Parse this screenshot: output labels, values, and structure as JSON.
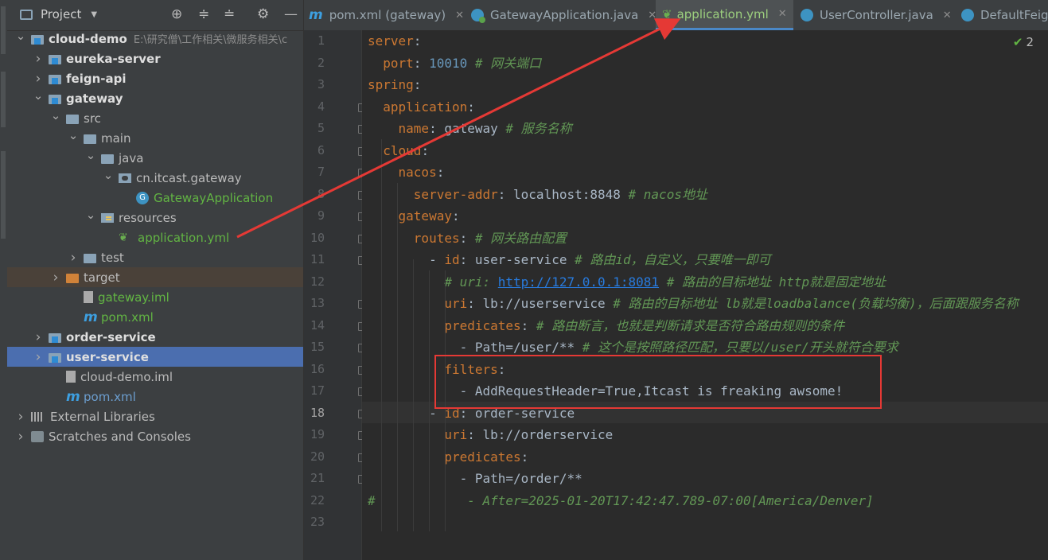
{
  "project_panel": {
    "title": "Project",
    "tree": [
      {
        "label": "cloud-demo",
        "path": "E:\\研究僧\\工作相关\\微服务相关\\c",
        "depth": 0,
        "expanded": true,
        "icon": "module-folder-icon",
        "style": "bold"
      },
      {
        "label": "eureka-server",
        "depth": 1,
        "expanded": false,
        "icon": "module-folder-icon",
        "style": "bold"
      },
      {
        "label": "feign-api",
        "depth": 1,
        "expanded": false,
        "icon": "module-folder-icon",
        "style": "bold"
      },
      {
        "label": "gateway",
        "depth": 1,
        "expanded": true,
        "icon": "module-folder-icon",
        "style": "bold"
      },
      {
        "label": "src",
        "depth": 2,
        "expanded": true,
        "icon": "folder-icon",
        "style": "normal"
      },
      {
        "label": "main",
        "depth": 3,
        "expanded": true,
        "icon": "folder-icon",
        "style": "normal"
      },
      {
        "label": "java",
        "depth": 4,
        "expanded": true,
        "icon": "source-folder-icon",
        "style": "normal"
      },
      {
        "label": "cn.itcast.gateway",
        "depth": 5,
        "expanded": true,
        "icon": "package-icon",
        "style": "normal"
      },
      {
        "label": "GatewayApplication",
        "depth": 6,
        "icon": "spring-class-icon",
        "style": "green"
      },
      {
        "label": "resources",
        "depth": 4,
        "expanded": true,
        "icon": "resources-folder-icon",
        "style": "normal"
      },
      {
        "label": "application.yml",
        "depth": 5,
        "icon": "spring-yaml-icon",
        "style": "green"
      },
      {
        "label": "test",
        "depth": 3,
        "expanded": false,
        "icon": "folder-icon",
        "style": "normal"
      },
      {
        "label": "target",
        "depth": 2,
        "expanded": false,
        "icon": "excluded-folder-icon",
        "style": "normal",
        "row": "excluded"
      },
      {
        "label": "gateway.iml",
        "depth": 3,
        "icon": "iml-file-icon",
        "style": "green"
      },
      {
        "label": "pom.xml",
        "depth": 3,
        "icon": "maven-icon",
        "style": "green"
      },
      {
        "label": "order-service",
        "depth": 1,
        "expanded": false,
        "icon": "module-folder-icon",
        "style": "bold"
      },
      {
        "label": "user-service",
        "depth": 1,
        "expanded": false,
        "icon": "module-folder-icon",
        "style": "bold",
        "row": "selected"
      },
      {
        "label": "cloud-demo.iml",
        "depth": 2,
        "icon": "iml-file-icon",
        "style": "normal"
      },
      {
        "label": "pom.xml",
        "depth": 2,
        "icon": "maven-icon",
        "style": "blue"
      },
      {
        "label": "External Libraries",
        "depth": 0,
        "expanded": false,
        "icon": "libraries-icon",
        "style": "normal"
      },
      {
        "label": "Scratches and Consoles",
        "depth": 0,
        "expanded": false,
        "icon": "scratches-icon",
        "style": "normal"
      }
    ]
  },
  "tabs": [
    {
      "label": "pom.xml (gateway)",
      "icon": "maven-icon",
      "active": false
    },
    {
      "label": "GatewayApplication.java",
      "icon": "spring-class-icon",
      "active": false
    },
    {
      "label": "application.yml",
      "icon": "spring-yaml-icon",
      "active": true
    },
    {
      "label": "UserController.java",
      "icon": "class-icon",
      "active": false
    },
    {
      "label": "DefaultFeig",
      "icon": "class-icon",
      "active": false
    }
  ],
  "editor": {
    "inspection_count": "2",
    "current_line": 18,
    "lines": [
      {
        "n": "1",
        "indent": 0,
        "tokens": [
          [
            "k",
            "server"
          ],
          [
            "v",
            ":"
          ]
        ]
      },
      {
        "n": "2",
        "indent": 2,
        "tokens": [
          [
            "k",
            "port"
          ],
          [
            "v",
            ": "
          ],
          [
            "n",
            "10010"
          ],
          [
            "c",
            " # 网关端口"
          ]
        ]
      },
      {
        "n": "3",
        "indent": 0,
        "tokens": [
          [
            "k",
            "spring"
          ],
          [
            "v",
            ":"
          ]
        ]
      },
      {
        "n": "4",
        "indent": 2,
        "tokens": [
          [
            "k",
            "application"
          ],
          [
            "v",
            ":"
          ]
        ]
      },
      {
        "n": "5",
        "indent": 4,
        "tokens": [
          [
            "k",
            "name"
          ],
          [
            "v",
            ": gateway"
          ],
          [
            "c",
            " # 服务名称"
          ]
        ]
      },
      {
        "n": "6",
        "indent": 2,
        "tokens": [
          [
            "k",
            "cloud"
          ],
          [
            "v",
            ":"
          ]
        ]
      },
      {
        "n": "7",
        "indent": 4,
        "tokens": [
          [
            "k",
            "nacos"
          ],
          [
            "v",
            ":"
          ]
        ]
      },
      {
        "n": "8",
        "indent": 6,
        "tokens": [
          [
            "k",
            "server-addr"
          ],
          [
            "v",
            ": localhost:8848"
          ],
          [
            "c",
            " # nacos地址"
          ]
        ]
      },
      {
        "n": "9",
        "indent": 4,
        "tokens": [
          [
            "k",
            "gateway"
          ],
          [
            "v",
            ":"
          ]
        ]
      },
      {
        "n": "10",
        "indent": 6,
        "tokens": [
          [
            "k",
            "routes"
          ],
          [
            "v",
            ":"
          ],
          [
            "c",
            " # 网关路由配置"
          ]
        ]
      },
      {
        "n": "11",
        "indent": 8,
        "tokens": [
          [
            "v",
            "- "
          ],
          [
            "k",
            "id"
          ],
          [
            "v",
            ": user-service"
          ],
          [
            "c",
            " # 路由id，自定义，只要唯一即可"
          ]
        ]
      },
      {
        "n": "12",
        "indent": 10,
        "tokens": [
          [
            "c",
            "# uri: "
          ],
          [
            "u",
            "http://127.0.0.1:8081"
          ],
          [
            "c",
            " # 路由的目标地址 http就是固定地址"
          ]
        ]
      },
      {
        "n": "13",
        "indent": 10,
        "tokens": [
          [
            "k",
            "uri"
          ],
          [
            "v",
            ": lb://userservice"
          ],
          [
            "c",
            " # 路由的目标地址 lb就是loadbalance(负载均衡)，后面跟服务名称"
          ]
        ]
      },
      {
        "n": "14",
        "indent": 10,
        "tokens": [
          [
            "k",
            "predicates"
          ],
          [
            "v",
            ":"
          ],
          [
            "c",
            " # 路由断言，也就是判断请求是否符合路由规则的条件"
          ]
        ]
      },
      {
        "n": "15",
        "indent": 12,
        "tokens": [
          [
            "v",
            "- Path=/user/**"
          ],
          [
            "c",
            " # 这个是按照路径匹配，只要以/user/开头就符合要求"
          ]
        ]
      },
      {
        "n": "16",
        "indent": 10,
        "tokens": [
          [
            "k",
            "filters"
          ],
          [
            "v",
            ":"
          ]
        ]
      },
      {
        "n": "17",
        "indent": 12,
        "tokens": [
          [
            "v",
            "- AddRequestHeader=True,Itcast is freaking awsome!"
          ]
        ]
      },
      {
        "n": "18",
        "indent": 8,
        "tokens": [
          [
            "v",
            "- "
          ],
          [
            "k",
            "id"
          ],
          [
            "v",
            ": order-service"
          ]
        ]
      },
      {
        "n": "19",
        "indent": 10,
        "tokens": [
          [
            "k",
            "uri"
          ],
          [
            "v",
            ": lb://orderservice"
          ]
        ]
      },
      {
        "n": "20",
        "indent": 10,
        "tokens": [
          [
            "k",
            "predicates"
          ],
          [
            "v",
            ":"
          ]
        ]
      },
      {
        "n": "21",
        "indent": 12,
        "tokens": [
          [
            "v",
            "- Path=/order/**"
          ]
        ]
      },
      {
        "n": "22",
        "indent": 0,
        "tokens": [
          [
            "c",
            "#            - After=2025-01-20T17:42:47.789-07:00[America/Denver]"
          ]
        ]
      },
      {
        "n": "23",
        "indent": 0,
        "tokens": []
      }
    ]
  },
  "colors": {
    "highlight_box": "#e53935",
    "arrow": "#e53935",
    "selected_row": "#4b6eaf"
  }
}
